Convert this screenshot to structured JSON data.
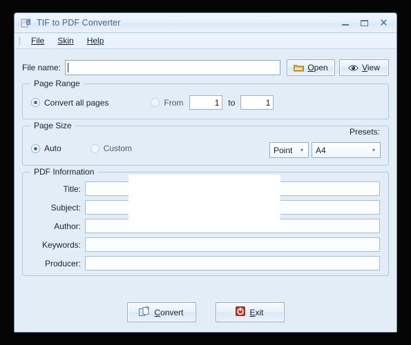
{
  "window": {
    "title": "TIF to PDF Converter",
    "app_icon": "document-printer-icon",
    "controls": {
      "minimize": "minimize-button",
      "maximize": "maximize-button",
      "close": "close-button",
      "close_glyph": "✕"
    }
  },
  "menu": {
    "items": [
      {
        "label": "File",
        "accel": "F"
      },
      {
        "label": "Skin",
        "accel": "S"
      },
      {
        "label": "Help",
        "accel": "H"
      }
    ]
  },
  "file_row": {
    "label": "File name:",
    "value": "",
    "placeholder": "",
    "open_button": {
      "label_pre": "",
      "accel": "O",
      "label_post": "pen",
      "icon": "folder-icon"
    },
    "view_button": {
      "label_pre": "",
      "accel": "V",
      "label_post": "iew",
      "icon": "eye-icon"
    }
  },
  "page_range": {
    "legend": "Page Range",
    "all_pages": {
      "label": "Convert all pages",
      "selected": true
    },
    "from": {
      "label": "From",
      "selected": false,
      "value": "1"
    },
    "to": {
      "label": "to",
      "value": "1"
    }
  },
  "page_size": {
    "legend": "Page Size",
    "auto": {
      "label": "Auto",
      "selected": true
    },
    "custom": {
      "label": "Custom",
      "selected": false
    },
    "unit": {
      "value": "Point",
      "arrow": "▾"
    },
    "presets_label": "Presets:",
    "preset": {
      "value": "A4",
      "arrow": "▾"
    }
  },
  "pdf_information": {
    "legend": "PDF Information",
    "fields": [
      {
        "label": "Title:",
        "value": ""
      },
      {
        "label": "Subject:",
        "value": ""
      },
      {
        "label": "Author:",
        "value": ""
      },
      {
        "label": "Keywords:",
        "value": ""
      },
      {
        "label": "Producer:",
        "value": ""
      }
    ]
  },
  "footer": {
    "convert": {
      "label_pre": "",
      "accel": "C",
      "label_post": "onvert",
      "icon": "convert-pages-icon"
    },
    "exit": {
      "label_pre": "",
      "accel": "E",
      "label_post": "xit",
      "icon": "power-exit-icon"
    }
  },
  "colors": {
    "window_bg": "#e2edf8",
    "titlebar_text": "#4b6480",
    "accent_radio": "#3c6d9e",
    "folder_icon": "#e8b84b",
    "exit_icon": "#c0392b",
    "border": "#b3c8da",
    "overlay": "#ffffff"
  }
}
